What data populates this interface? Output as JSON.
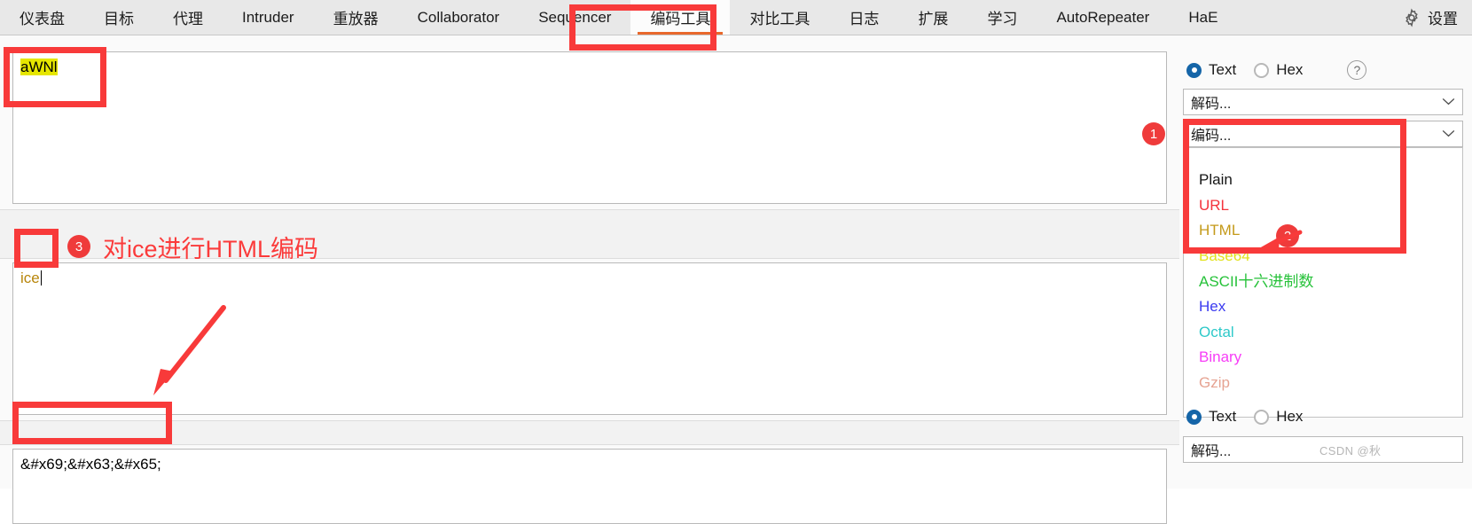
{
  "tabs": [
    {
      "label": "仪表盘",
      "active": false
    },
    {
      "label": "目标",
      "active": false
    },
    {
      "label": "代理",
      "active": false
    },
    {
      "label": "Intruder",
      "active": false
    },
    {
      "label": "重放器",
      "active": false
    },
    {
      "label": "Collaborator",
      "active": false
    },
    {
      "label": "Sequencer",
      "active": false
    },
    {
      "label": "编码工具",
      "active": true
    },
    {
      "label": "对比工具",
      "active": false
    },
    {
      "label": "日志",
      "active": false
    },
    {
      "label": "扩展",
      "active": false
    },
    {
      "label": "学习",
      "active": false
    },
    {
      "label": "AutoRepeater",
      "active": false
    },
    {
      "label": "HaE",
      "active": false
    }
  ],
  "settings": {
    "label": "设置",
    "icon": "gear-icon"
  },
  "editors": {
    "top": {
      "value": "aWNl",
      "highlight": true
    },
    "middle": {
      "value": "ice",
      "has_caret": true
    },
    "bottom": {
      "value": "&#x69;&#x63;&#x65;"
    }
  },
  "right_panel": {
    "top": {
      "radio_text": "Text",
      "radio_hex": "Hex",
      "selected": "Text",
      "help_glyph": "?",
      "decode_select": "解码...",
      "encode_select": "编码...",
      "dropdown_items": [
        {
          "label": "Plain",
          "color": "#161616"
        },
        {
          "label": "URL",
          "color": "#f4333c"
        },
        {
          "label": "HTML",
          "color": "#c49a1a"
        },
        {
          "label": "Base64",
          "color": "#e2e21a"
        },
        {
          "label": "ASCII十六进制数",
          "color": "#27c23a"
        },
        {
          "label": "Hex",
          "color": "#3b3bf0"
        },
        {
          "label": "Octal",
          "color": "#2ec9c9"
        },
        {
          "label": "Binary",
          "color": "#f73df7"
        },
        {
          "label": "Gzip",
          "color": "#e6a392"
        }
      ]
    },
    "bottom": {
      "radio_text": "Text",
      "radio_hex": "Hex",
      "selected": "Text",
      "decode_select": "解码..."
    }
  },
  "annotations": {
    "badge_1": "1",
    "badge_2": "2",
    "badge_3": "3",
    "note_3": "对ice进行HTML编码",
    "accent_color": "#f83a3a"
  },
  "watermark": "CSDN @秋"
}
